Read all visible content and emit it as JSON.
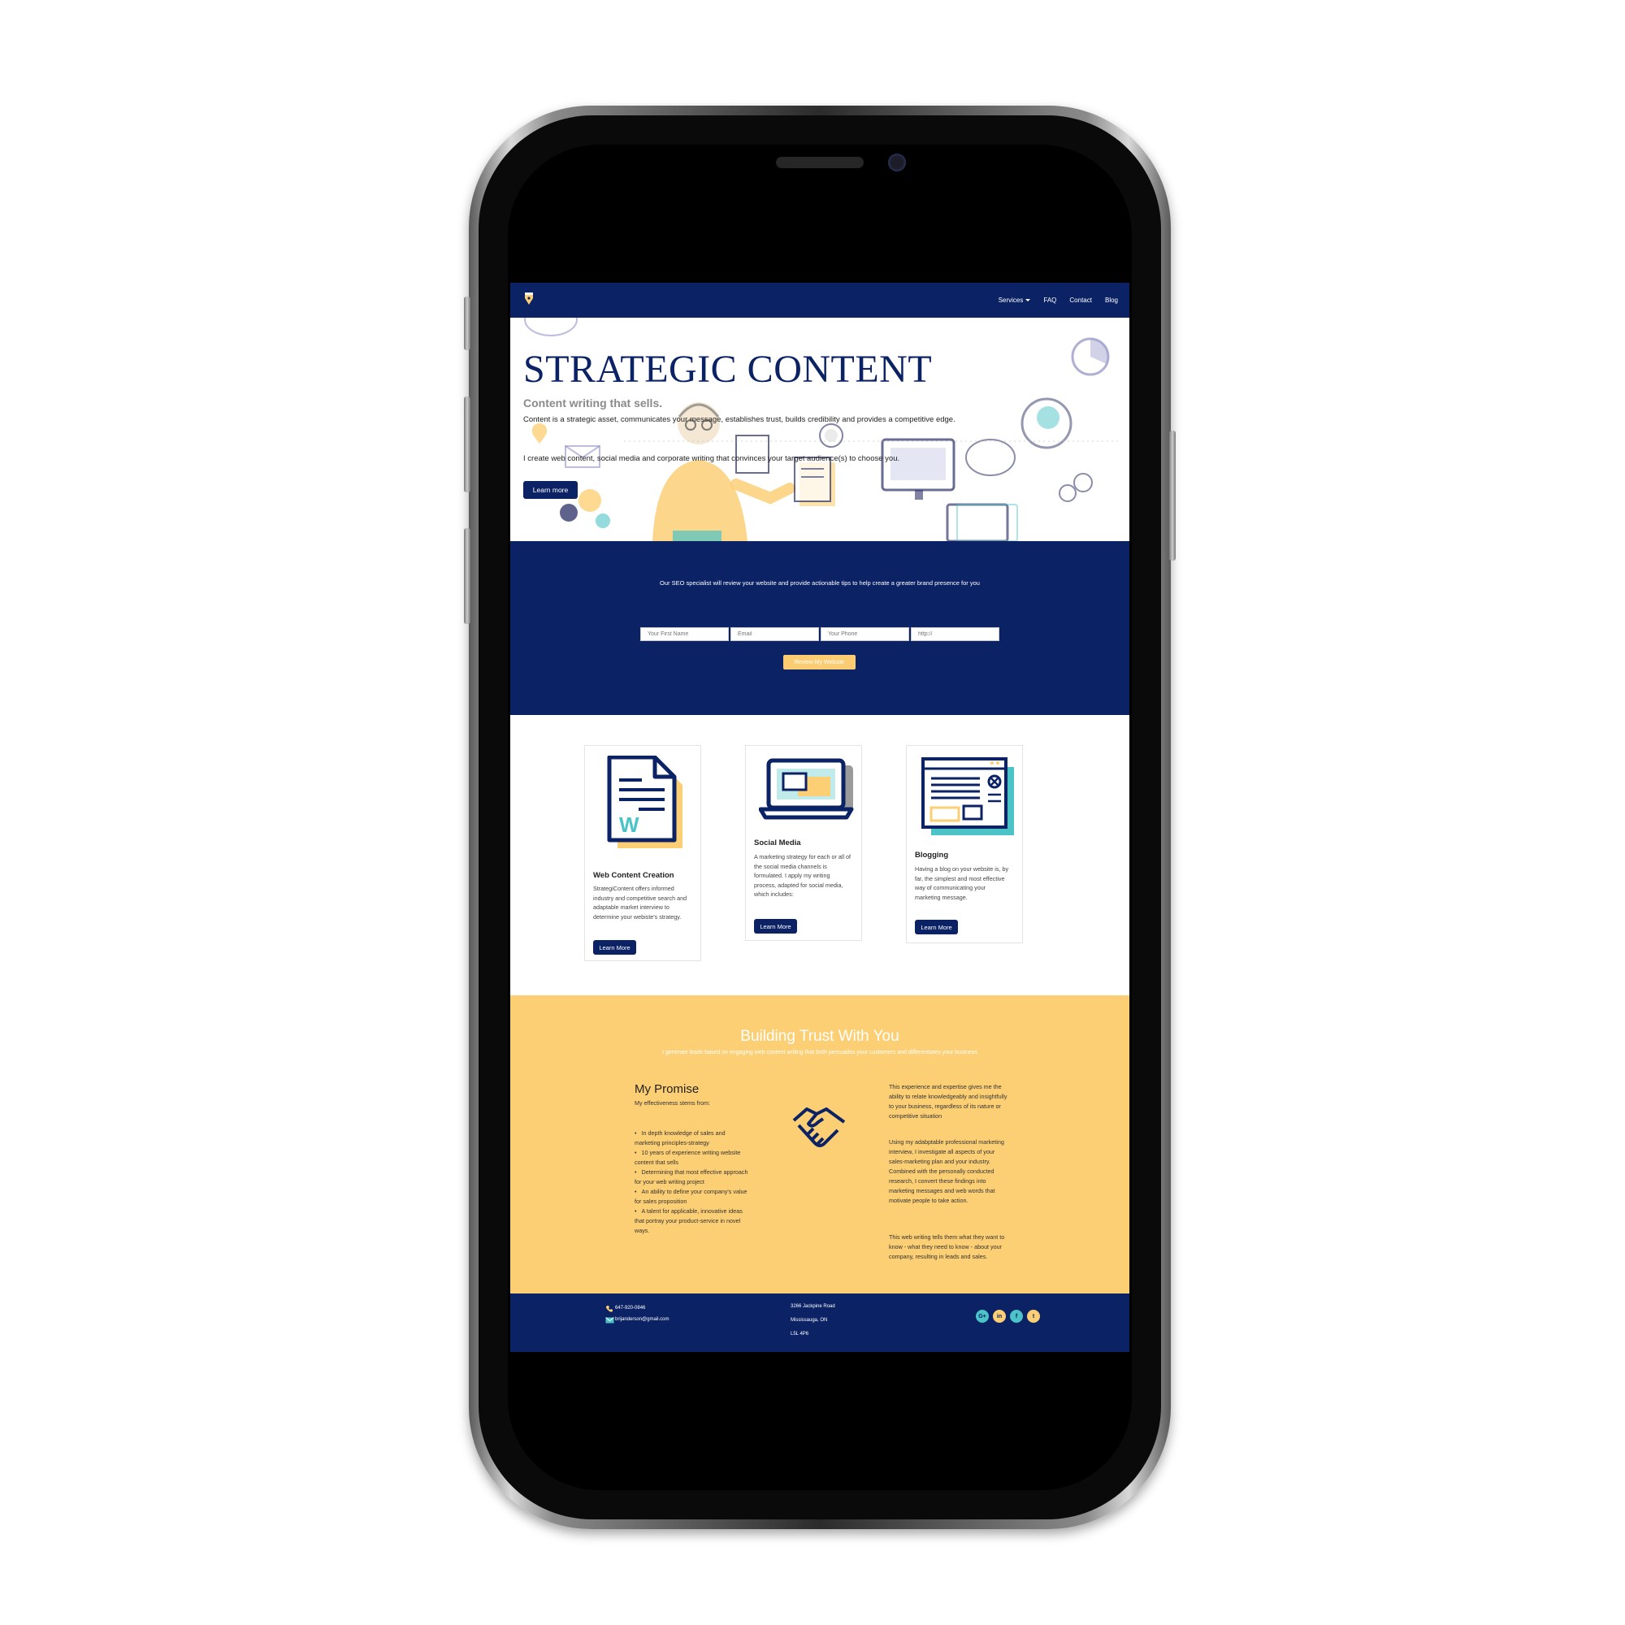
{
  "nav": {
    "items": [
      {
        "label": "Services",
        "has_dropdown": true
      },
      {
        "label": "FAQ"
      },
      {
        "label": "Contact"
      },
      {
        "label": "Blog"
      }
    ]
  },
  "hero": {
    "title": "STRATEGIC CONTENT",
    "subtitle": "Content writing that sells.",
    "paragraph1": "Content is a strategic asset, communicates your message, establishes trust, builds credibility and provides a competitive edge.",
    "paragraph2": "I create web content, social media and corporate writing that convinces your target audience(s) to choose you.",
    "button": "Learn more"
  },
  "seo": {
    "text": "Our SEO specialist will review your website and provide actionable tips to help create a greater brand presence for you",
    "fields": [
      {
        "placeholder": "Your First Name"
      },
      {
        "placeholder": "Email"
      },
      {
        "placeholder": "Your Phone"
      },
      {
        "placeholder": "http://"
      }
    ],
    "button": "Review My Website"
  },
  "services": [
    {
      "title": "Web Content Creation",
      "text": "StrategiContent offers informed industry and competitive search and adaptable market interview to determine your webiste's strategy.",
      "button": "Learn More"
    },
    {
      "title": "Social Media",
      "text": "A marketing strategy for each or all of the social media channels is formulated. I apply my writing process, adapted for social media, which includes:",
      "button": "Learn More"
    },
    {
      "title": "Blogging",
      "text": "Having a blog on your website is, by far, the simplest and most effective way of communicating your marketing message.",
      "button": "Learn More"
    }
  ],
  "trust": {
    "title": "Building Trust With You",
    "subtitle": "I generate leads based on engaging web content writing that both persuades your customers and differentiates your business",
    "promise_heading": "My Promise",
    "promise_sub": "My effectiveness stems from:",
    "promise_items": [
      "In depth knowledge of sales and marketing principles-strategy",
      "10 years of experience writing website content that sells",
      "Determining that most effective approach for your web writing project",
      "An ability to define your company's value for sales proposition",
      "A talent for applicable, innovative ideas that portray your product-service in novel ways."
    ],
    "right_p1": "This experience and expertise gives me the ability to relate knowledgeably and insightfully to your business, regardless of its nature or competitive situation",
    "right_p2": "Using my adabptable professional marketing interview, I investigate all aspects of your sales-marketing plan and your industry. Combined with the personally conducted research, I convert these findings into marketing messages and web words that motivate people to take action.",
    "right_p3": "This web writing tells them what they want to know - what they need to know - about your company, resulting in leads and sales."
  },
  "footer": {
    "phone": "647-920-0846",
    "email": "brijanderson@gmail.com",
    "address1": "3266 Jackpine Road",
    "address2": "Mississauga, ON",
    "address3": "L5L 4P6",
    "social": [
      {
        "icon": "google-plus-icon",
        "glyph": "G+",
        "color": "#4cc3c6"
      },
      {
        "icon": "linkedin-icon",
        "glyph": "in",
        "color": "#fccf75"
      },
      {
        "icon": "facebook-icon",
        "glyph": "f",
        "color": "#4cc3c6"
      },
      {
        "icon": "twitter-icon",
        "glyph": "t",
        "color": "#fccf75"
      }
    ]
  },
  "colors": {
    "navy": "#0b2265",
    "yellow": "#fccf75",
    "teal": "#4cc3c6"
  }
}
